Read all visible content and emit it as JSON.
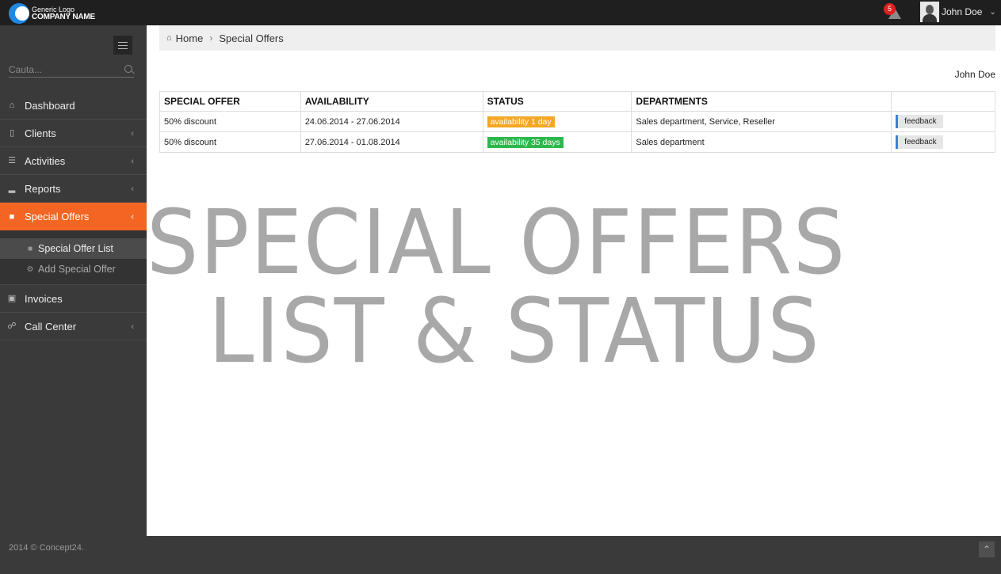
{
  "header": {
    "logo_line1": "Generic Logo",
    "logo_line2": "COMPANY NAME",
    "notification_count": "5",
    "user_name": "John Doe"
  },
  "sidebar": {
    "search_placeholder": "Cauta...",
    "items": [
      {
        "label": "Dashboard",
        "icon": "home-icon"
      },
      {
        "label": "Clients",
        "icon": "bookmark-icon"
      },
      {
        "label": "Activities",
        "icon": "list-icon"
      },
      {
        "label": "Reports",
        "icon": "bar-chart-icon"
      },
      {
        "label": "Special Offers",
        "icon": "gift-icon"
      },
      {
        "label": "Invoices",
        "icon": "money-icon"
      },
      {
        "label": "Call Center",
        "icon": "headset-icon"
      }
    ],
    "submenu": [
      {
        "label": "Special Offer List",
        "icon": "gift-icon"
      },
      {
        "label": "Add Special Offer",
        "icon": "cogs-icon"
      }
    ]
  },
  "breadcrumb": {
    "home": "Home",
    "current": "Special Offers"
  },
  "owner_name": "John Doe",
  "table": {
    "headers": [
      "SPECIAL OFFER",
      "AVAILABILITY",
      "STATUS",
      "DEPARTMENTS",
      ""
    ],
    "rows": [
      {
        "offer": "50% discount",
        "availability": "24.06.2014 - 27.06.2014",
        "status": "availability 1 day",
        "status_color": "#f5a623",
        "departments": "Sales department, Service, Reseller",
        "action": "feedback"
      },
      {
        "offer": "50% discount",
        "availability": "27.06.2014 - 01.08.2014",
        "status": "availability 35 days",
        "status_color": "#2db84d",
        "departments": "Sales department",
        "action": "feedback"
      }
    ]
  },
  "overlay": {
    "line1": "SPECIAL OFFERS",
    "line2": "LIST & STATUS"
  },
  "footer": {
    "copyright": "2014 © Concept24."
  },
  "colors": {
    "accent": "#f26522",
    "topbar": "#1f1f1f",
    "sidebar": "#3a3a3a"
  }
}
